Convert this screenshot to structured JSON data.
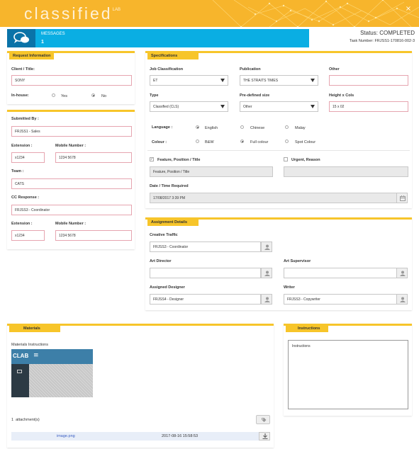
{
  "header": {
    "logo_text": "classified",
    "logo_sup": "LAB",
    "close_glyph": "×"
  },
  "messages": {
    "label": "MESSAGES",
    "count": "1"
  },
  "status": {
    "text": "Status: COMPLETED",
    "task_number": "Task Number: FRJSS1-170816-002-3"
  },
  "request_info": {
    "title": "Request Information",
    "client_label": "Client / Title:",
    "client_value": "SONY",
    "inhouse_label": "In-house:",
    "yes": "Yes",
    "no": "No"
  },
  "submitted": {
    "submitted_by_label": "Submitted By :",
    "submitted_by_value": "FRJSS1 - Sales",
    "extension_label": "Extension :",
    "extension_value": "x1234",
    "mobile_label": "Mobile Number :",
    "mobile_value": "1234 5678",
    "team_label": "Team :",
    "team_value": "CATS",
    "cc_label": "CC Response :",
    "cc_value": "FRJSS3 - Coordinator",
    "extension2_label": "Extension :",
    "extension2_value": "x1234",
    "mobile2_label": "Mobile Number :",
    "mobile2_value": "1234 5678"
  },
  "specs": {
    "title": "Specifications",
    "job_class_label": "Job Classification",
    "job_class_value": "ET",
    "publication_label": "Publication",
    "publication_value": "THE STRAITS TIMES",
    "other_label": "Other",
    "other_value": "",
    "type_label": "Type",
    "type_value": "Classified (CLS)",
    "predef_label": "Pre-defined size",
    "predef_value": "Other",
    "hxc_label": "Height x Cols",
    "hxc_value": "15 x 02",
    "language_label": "Language :",
    "english": "English",
    "chinese": "Chinese",
    "malay": "Malay",
    "colour_label": "Colour :",
    "bw": "B&W",
    "full_colour": "Full colour",
    "spot_colour": "Spot Colour",
    "feature_label": "Feature, Position / Title",
    "feature_placeholder": "Feature, Position / Title",
    "urgent_label": "Urgent, Reason",
    "datetime_label": "Date / Time Required",
    "datetime_value": "17/08/2017 3:39 PM"
  },
  "assignment": {
    "title": "Assignment Details",
    "creative_label": "Creative Traffic",
    "creative_value": "FRJSS3 - Coordinator",
    "art_director_label": "Art Director",
    "art_director_value": "",
    "art_supervisor_label": "Art Supervisor",
    "art_supervisor_value": "",
    "designer_label": "Assigned Designer",
    "designer_value": "FRJSS4 - Designer",
    "writer_label": "Writer",
    "writer_value": "FRJSS3 - Copywriter"
  },
  "materials": {
    "title": "Materials",
    "subtitle": "Materials Instructions",
    "thumb_logo": "CLAB",
    "attachments_count": "1",
    "attachments_label": "attachment(s)",
    "file_name": "image.png",
    "file_date": "2017-08-16 15:58:53"
  },
  "instructions": {
    "title": "Instructions",
    "value": "Instructions"
  },
  "colors": {
    "accent": "#f7c52a",
    "header": "#f7b52c",
    "messages": "#0aaee3"
  },
  "icons": [
    "chat-bubbles-icon",
    "close-icon",
    "user-icon",
    "calendar-icon",
    "tag-icon",
    "download-icon",
    "hamburger-icon"
  ]
}
